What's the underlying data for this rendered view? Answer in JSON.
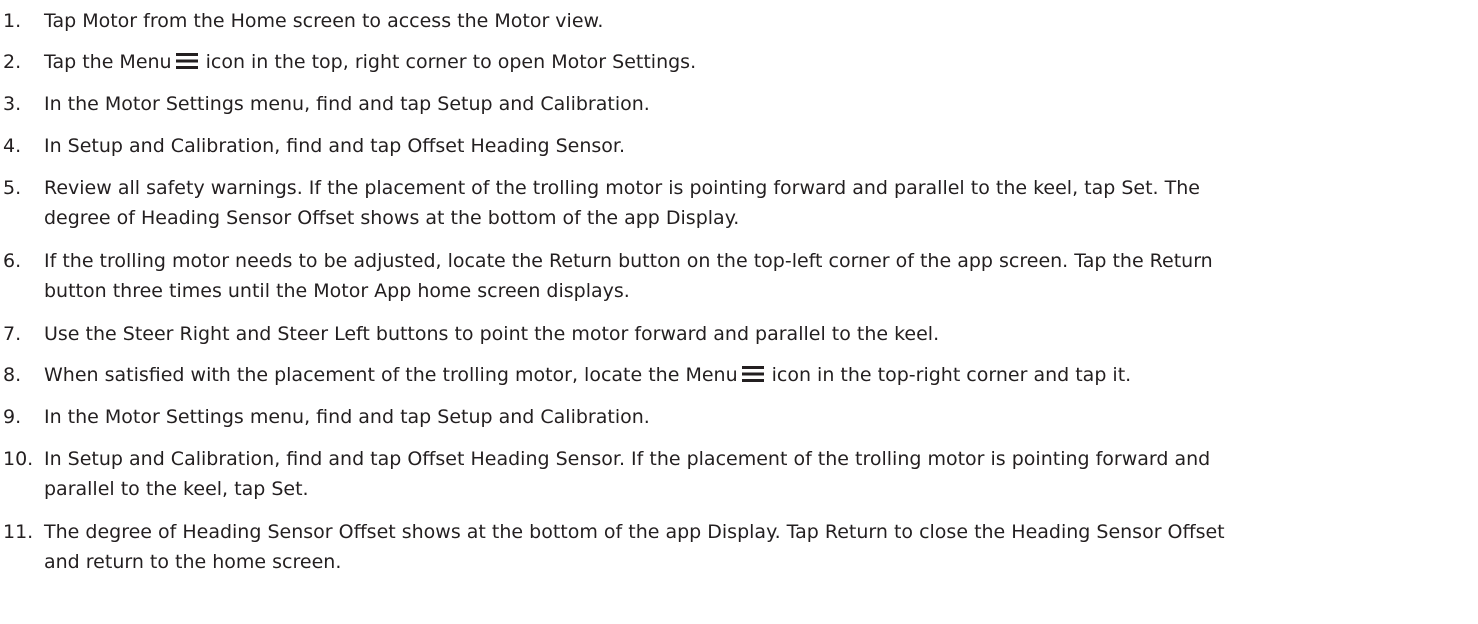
{
  "steps": [
    {
      "num": "1.",
      "lines": [
        "Tap Motor from the Home screen to access the Motor view."
      ]
    },
    {
      "num": "2.",
      "before": "Tap the Menu",
      "icon": "menu-icon",
      "after": "icon in the top, right corner to open Motor Settings."
    },
    {
      "num": "3.",
      "lines": [
        "In the Motor Settings menu, find and tap Setup and Calibration."
      ]
    },
    {
      "num": "4.",
      "lines": [
        "In Setup and Calibration, find and tap Offset Heading Sensor."
      ]
    },
    {
      "num": "5.",
      "lines": [
        "Review all safety warnings. If the placement of the trolling motor is pointing forward and parallel to the keel, tap Set. The",
        "degree of Heading Sensor Offset shows at the bottom of the app Display."
      ]
    },
    {
      "num": "6.",
      "lines": [
        "If the trolling motor needs to be adjusted, locate the Return button on the top-left corner of the app screen. Tap the Return",
        "button three times until the Motor App home screen displays."
      ]
    },
    {
      "num": "7.",
      "lines": [
        "Use the Steer Right and Steer Left buttons to point the motor forward and parallel to the keel."
      ]
    },
    {
      "num": "8.",
      "before": "When satisfied with the placement of the trolling motor, locate the Menu",
      "icon": "menu-icon",
      "after": "icon in the top-right corner and tap it."
    },
    {
      "num": "9.",
      "lines": [
        "In the Motor Settings menu, find and tap Setup and Calibration."
      ]
    },
    {
      "num": "10.",
      "lines": [
        "In Setup and Calibration, find and tap Offset Heading Sensor. If the placement of the trolling motor is pointing forward and",
        "parallel to the keel, tap Set."
      ]
    },
    {
      "num": "11.",
      "lines": [
        "The degree of Heading Sensor Offset shows at the bottom of the app Display. Tap Return to close the Heading Sensor Offset",
        "and return to the home screen."
      ]
    }
  ]
}
